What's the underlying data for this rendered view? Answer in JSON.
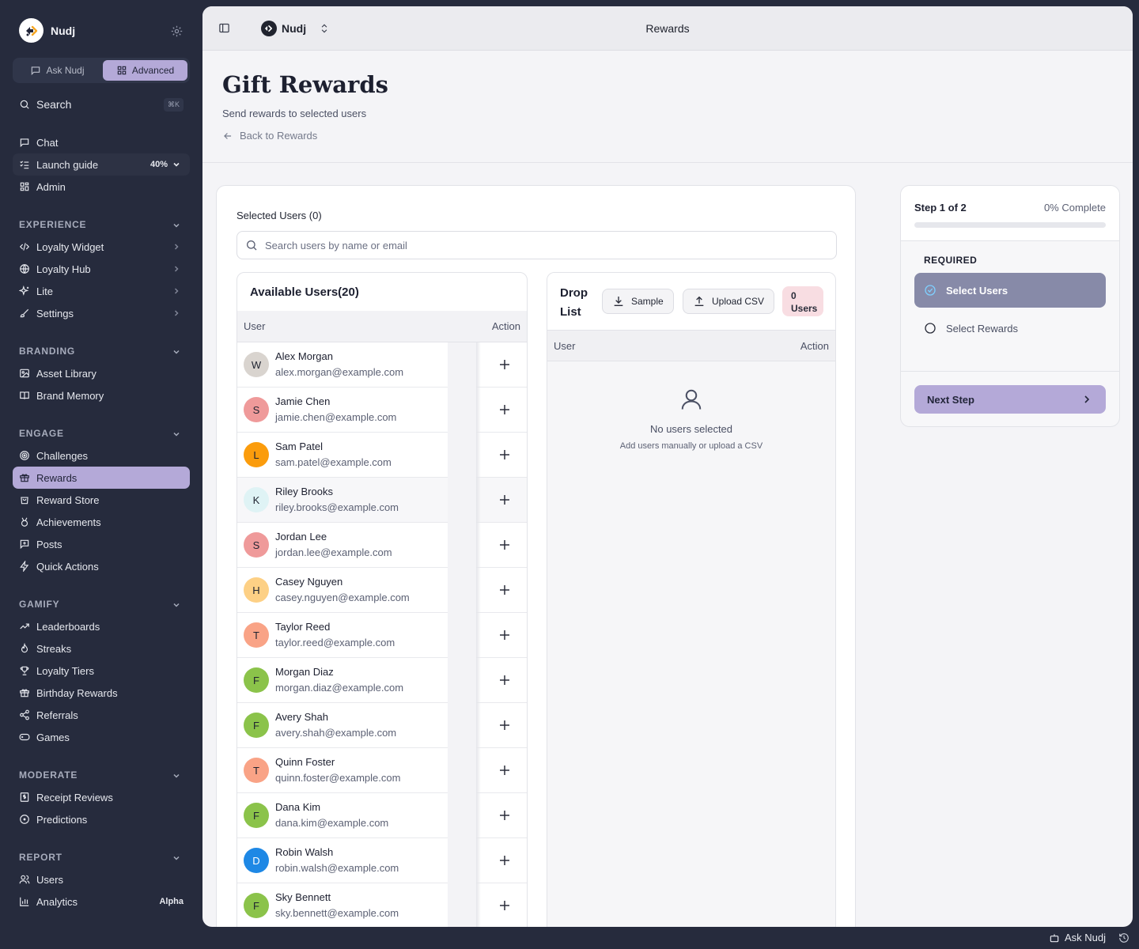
{
  "app": {
    "name": "Nudj"
  },
  "sidebar": {
    "modes": {
      "ask": "Ask Nudj",
      "advanced": "Advanced"
    },
    "search": {
      "label": "Search",
      "shortcut": "⌘K"
    },
    "top_items": [
      {
        "label": "Chat",
        "icon": "chat-icon"
      },
      {
        "label": "Launch guide",
        "icon": "checklist-icon",
        "progress": "40%"
      },
      {
        "label": "Admin",
        "icon": "dashboard-icon"
      }
    ],
    "sections": {
      "experience": {
        "title": "EXPERIENCE",
        "items": [
          "Loyalty Widget",
          "Loyalty Hub",
          "Lite",
          "Settings"
        ]
      },
      "branding": {
        "title": "BRANDING",
        "items": [
          "Asset Library",
          "Brand Memory"
        ]
      },
      "engage": {
        "title": "ENGAGE",
        "items": [
          "Challenges",
          "Rewards",
          "Reward Store",
          "Achievements",
          "Posts",
          "Quick Actions"
        ]
      },
      "gamify": {
        "title": "GAMIFY",
        "items": [
          "Leaderboards",
          "Streaks",
          "Loyalty Tiers",
          "Birthday Rewards",
          "Referrals",
          "Games"
        ]
      },
      "moderate": {
        "title": "MODERATE",
        "items": [
          "Receipt Reviews",
          "Predictions"
        ]
      },
      "report": {
        "title": "REPORT",
        "items": [
          "Users",
          "Analytics"
        ],
        "analytics_badge": "Alpha"
      }
    }
  },
  "topbar": {
    "brand": "Nudj",
    "title": "Rewards"
  },
  "page": {
    "title": "Gift Rewards",
    "subtitle": "Send rewards to selected users",
    "back_link": "Back to Rewards"
  },
  "selection": {
    "label": "Selected Users (0)",
    "search_placeholder": "Search users by name or email"
  },
  "available": {
    "title": "Available Users(20)",
    "col_user": "User",
    "col_action": "Action",
    "users": [
      {
        "initial": "W",
        "name": "Alex Morgan",
        "email": "alex.morgan@example.com",
        "color": "#d9d4cf"
      },
      {
        "initial": "S",
        "name": "Jamie Chen",
        "email": "jamie.chen@example.com",
        "color": "#ef9a9a"
      },
      {
        "initial": "L",
        "name": "Sam Patel",
        "email": "sam.patel@example.com",
        "color": "#fb9c0c"
      },
      {
        "initial": "K",
        "name": "Riley Brooks",
        "email": "riley.brooks@example.com",
        "color": "#dff3f5"
      },
      {
        "initial": "S",
        "name": "Jordan Lee",
        "email": "jordan.lee@example.com",
        "color": "#ef9a9a"
      },
      {
        "initial": "H",
        "name": "Casey Nguyen",
        "email": "casey.nguyen@example.com",
        "color": "#fdd085"
      },
      {
        "initial": "T",
        "name": "Taylor Reed",
        "email": "taylor.reed@example.com",
        "color": "#f9a386"
      },
      {
        "initial": "F",
        "name": "Morgan Diaz",
        "email": "morgan.diaz@example.com",
        "color": "#8bc34a"
      },
      {
        "initial": "F",
        "name": "Avery Shah",
        "email": "avery.shah@example.com",
        "color": "#8bc34a"
      },
      {
        "initial": "T",
        "name": "Quinn Foster",
        "email": "quinn.foster@example.com",
        "color": "#f9a386"
      },
      {
        "initial": "F",
        "name": "Dana Kim",
        "email": "dana.kim@example.com",
        "color": "#8bc34a"
      },
      {
        "initial": "D",
        "name": "Robin Walsh",
        "email": "robin.walsh@example.com",
        "color": "#1e88e5"
      },
      {
        "initial": "F",
        "name": "Sky Bennett",
        "email": "sky.bennett@example.com",
        "color": "#8bc34a"
      }
    ]
  },
  "droplist": {
    "title": "Drop List",
    "sample_label": "Sample",
    "upload_label": "Upload CSV",
    "count": "0",
    "count_label": "Users",
    "col_user": "User",
    "col_action": "Action",
    "empty_title": "No users selected",
    "empty_sub": "Add users manually or upload a CSV"
  },
  "stepper": {
    "step_label": "Step 1 of 2",
    "complete_label": "0% Complete",
    "progress_fraction": 0,
    "required_label": "REQUIRED",
    "steps": [
      "Select Users",
      "Select Rewards"
    ],
    "next_label": "Next Step"
  },
  "footer": {
    "ask_label": "Ask Nudj"
  },
  "colors": {
    "accent": "#b4a9d8",
    "sidebar_bg": "#262b3d",
    "active_step": "#878aa8"
  }
}
